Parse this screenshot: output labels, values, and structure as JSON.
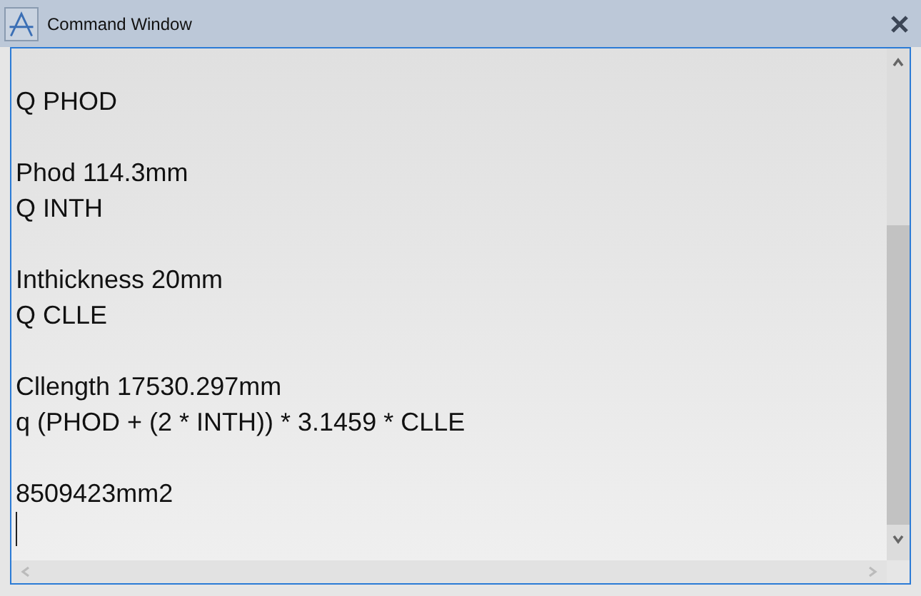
{
  "window": {
    "title": "Command Window"
  },
  "output_lines": [
    {
      "text": "Q PHOD",
      "blank_before": true
    },
    {
      "text": "Phod 114.3mm",
      "blank_before": true
    },
    {
      "text": "Q INTH",
      "blank_before": false
    },
    {
      "text": "Inthickness 20mm",
      "blank_before": true
    },
    {
      "text": "Q CLLE",
      "blank_before": false
    },
    {
      "text": "Cllength 17530.297mm",
      "blank_before": true
    },
    {
      "text": "q (PHOD + (2 * INTH)) * 3.1459 * CLLE",
      "blank_before": false
    },
    {
      "text": "8509423mm2",
      "blank_before": true
    }
  ]
}
